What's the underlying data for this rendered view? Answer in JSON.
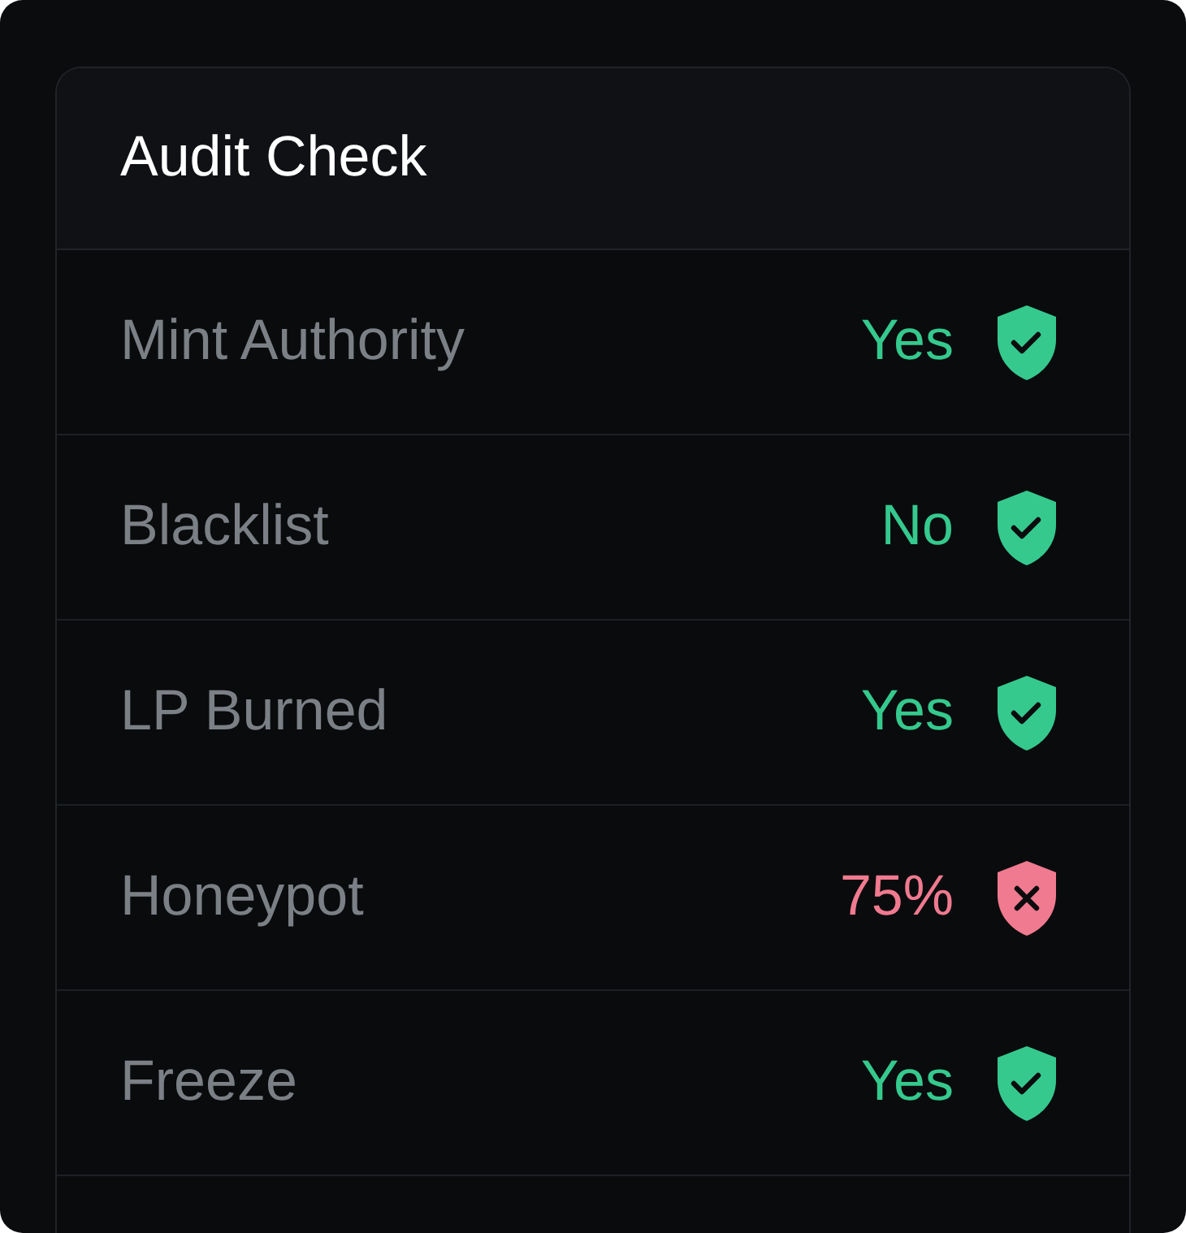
{
  "card": {
    "title": "Audit Check"
  },
  "checks": [
    {
      "label": "Mint Authority",
      "value": "Yes",
      "kind": "pass"
    },
    {
      "label": "Blacklist",
      "value": "No",
      "kind": "pass"
    },
    {
      "label": "LP Burned",
      "value": "Yes",
      "kind": "pass"
    },
    {
      "label": "Honeypot",
      "value": "75%",
      "kind": "fail"
    },
    {
      "label": "Freeze",
      "value": "Yes",
      "kind": "pass"
    }
  ]
}
